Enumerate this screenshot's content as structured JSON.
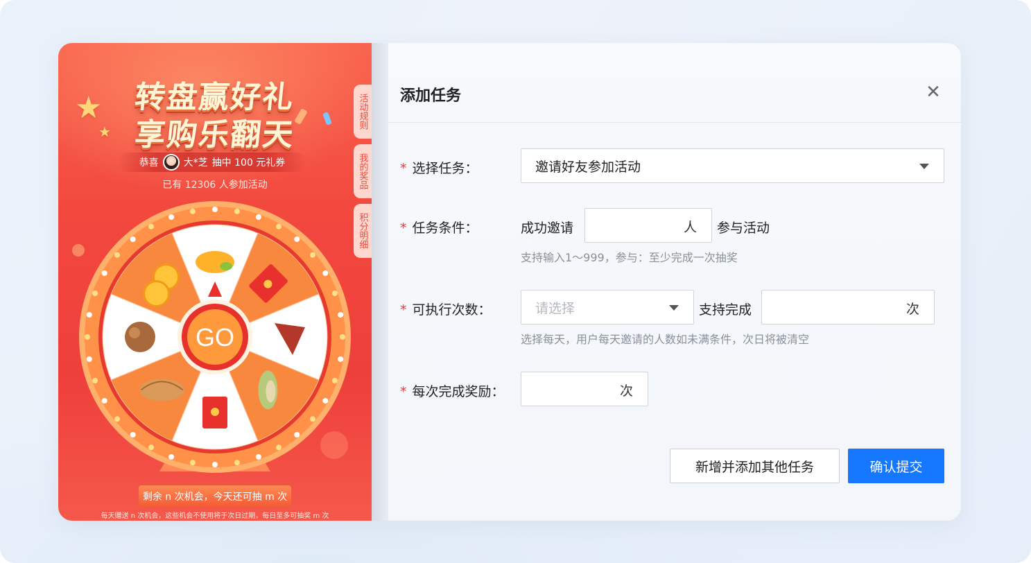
{
  "promo": {
    "title_line1": "转盘赢好礼",
    "title_line2": "享购乐翻天",
    "winner_prefix": "恭喜",
    "winner_name": "大*芝",
    "winner_suffix": "抽中 100 元礼券",
    "participants": "已有 12306 人参加活动",
    "side_tabs": [
      "活动规则",
      "我的奖品",
      "积分明细"
    ],
    "wheel_center": "GO",
    "chances": "剩余 n 次机会，今天还可抽 m 次",
    "footnote": "每天赠送 n 次机会，这些机会不使用将于次日过期，每日至多可抽奖 m 次",
    "wheel_prizes": [
      "mango-icon",
      "red-envelope-icon",
      "dates-icon",
      "pistachio-icon",
      "red-envelope-icon",
      "pastry-icon",
      "walnut-icon",
      "coins-icon"
    ],
    "colors": {
      "bg": "#f2483e",
      "wheel_rim": "#ff9a55",
      "slice_orange": "#f7883e",
      "slice_white": "#ffffff"
    }
  },
  "dialog": {
    "title": "添加任务",
    "close_icon": "close-icon",
    "task_select": {
      "label": "选择任务：",
      "value": "邀请好友参加活动"
    },
    "condition": {
      "label": "任务条件：",
      "prefix": "成功邀请",
      "unit": "人",
      "suffix": "参与活动",
      "value": "",
      "hint": "支持输入1～999，参与：至少完成一次抽奖"
    },
    "times": {
      "label": "可执行次数：",
      "placeholder": "请选择",
      "middle": "支持完成",
      "unit": "次",
      "value": "",
      "hint": "选择每天，用户每天邀请的人数如未满条件，次日将被清空"
    },
    "reward": {
      "label": "每次完成奖励：",
      "unit": "次",
      "value": ""
    },
    "buttons": {
      "secondary": "新增并添加其他任务",
      "primary": "确认提交"
    },
    "colors": {
      "primary": "#1677ff",
      "required": "#e83b3b"
    }
  }
}
